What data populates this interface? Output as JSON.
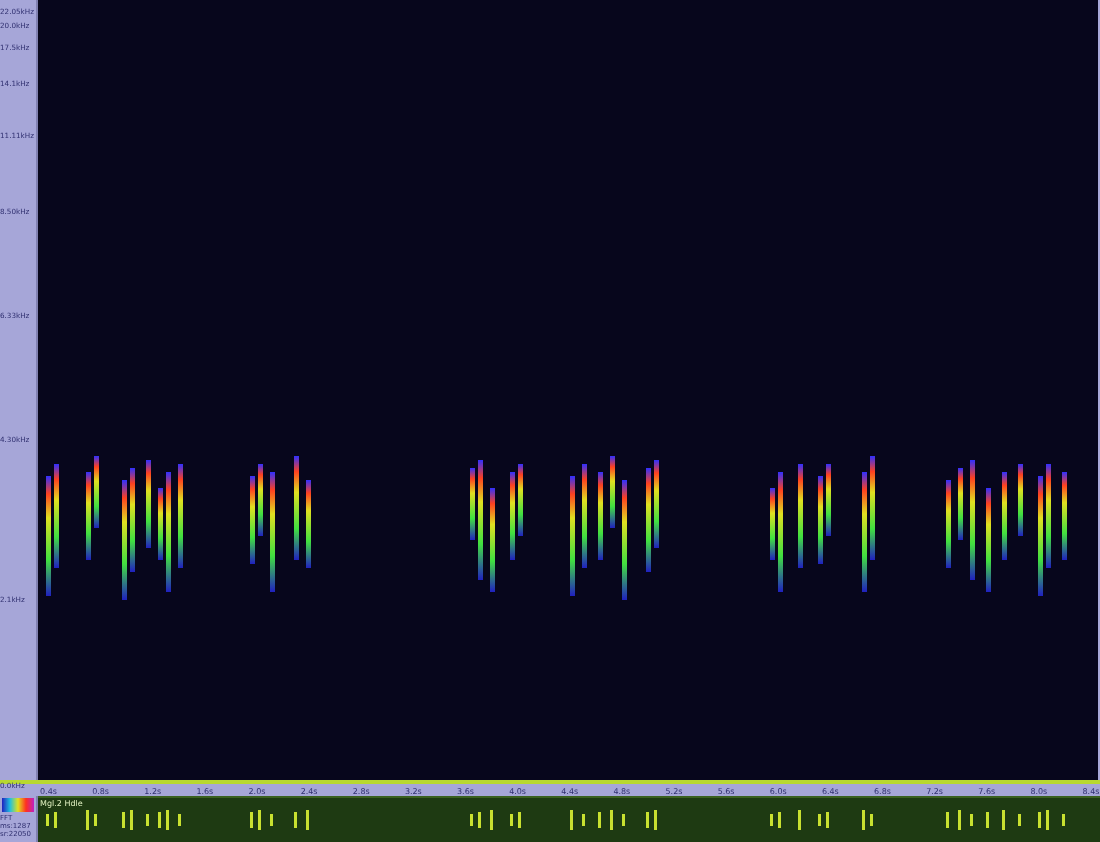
{
  "frequency_axis": {
    "labels": [
      "22.05kHz",
      "20.0kHz",
      "17.5kHz",
      "14.1kHz",
      "11.11kHz",
      "8.50kHz",
      "6.33kHz",
      "4.30kHz",
      "2.1kHz",
      "0.0kHz"
    ]
  },
  "time_ruler": {
    "labels": [
      "0.4s",
      "0.8s",
      "1.2s",
      "1.6s",
      "2.0s",
      "2.4s",
      "2.8s",
      "3.2s",
      "3.6s",
      "4.0s",
      "4.4s",
      "4.8s",
      "5.2s",
      "5.6s",
      "6.0s",
      "6.4s",
      "6.8s",
      "7.2s",
      "7.6s",
      "8.0s",
      "8.4s"
    ]
  },
  "info_panel": {
    "lines": [
      "FFT",
      "ms:1287",
      "sr:22050"
    ]
  },
  "track": {
    "label": "Mgl.2 Hdle"
  }
}
